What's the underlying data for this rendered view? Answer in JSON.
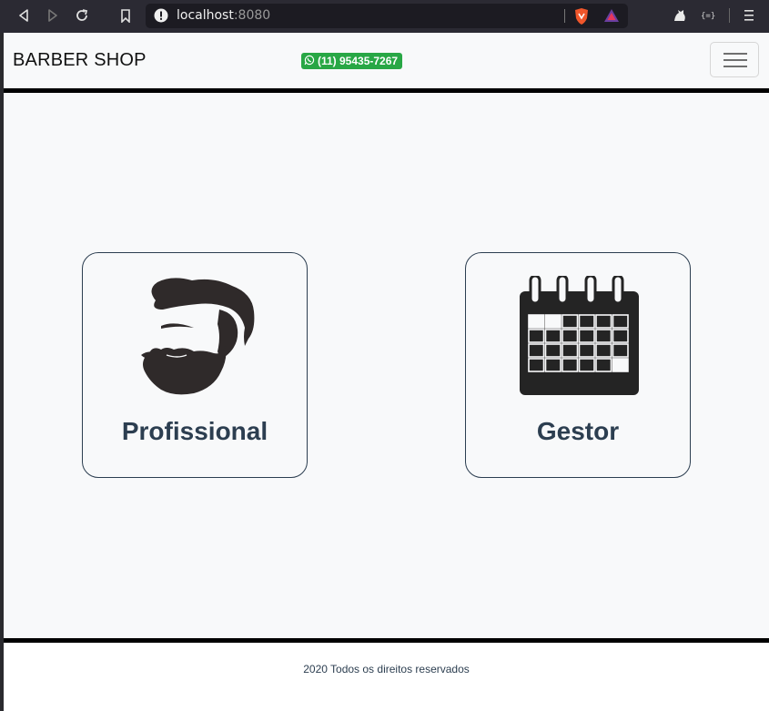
{
  "browser": {
    "url_host": "localhost",
    "url_port": ":8080"
  },
  "navbar": {
    "brand": "BARBER SHOP",
    "phone": "(11) 95435-7267"
  },
  "cards": [
    {
      "label": "Profissional",
      "icon": "bearded-man-icon"
    },
    {
      "label": "Gestor",
      "icon": "calendar-icon"
    }
  ],
  "footer": {
    "copyright": "2020 Todos os direitos reservados"
  },
  "colors": {
    "accent_text": "#2c3e50",
    "whatsapp_badge": "#28a745",
    "page_bg": "#f8f9fa"
  }
}
